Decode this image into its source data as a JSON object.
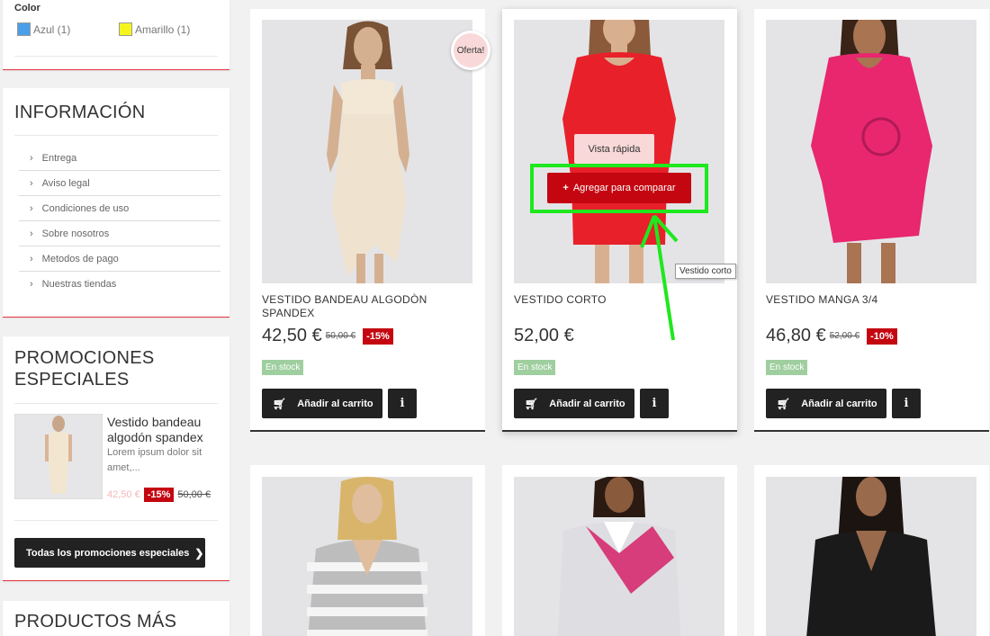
{
  "filter": {
    "color_label": "Color",
    "options": [
      {
        "label": "Azul (1)",
        "color": "#4a9fe8"
      },
      {
        "label": "Amarillo (1)",
        "color": "#f5f51e"
      }
    ]
  },
  "info_block": {
    "title": "INFORMACIÓN",
    "links": [
      "Entrega",
      "Aviso legal",
      "Condiciones de uso",
      "Sobre nosotros",
      "Metodos de pago",
      "Nuestras tiendas"
    ]
  },
  "promo_block": {
    "title": "PROMOCIONES ESPECIALES",
    "product_name": "Vestido bandeau algodón spandex",
    "description": "Lorem ipsum dolor sit amet,...",
    "price": "42,50 €",
    "discount": "-15%",
    "old_price": "50,00 €",
    "all_button": "Todas los promociones especiales"
  },
  "more_block": {
    "title": "PRODUCTOS MÁS"
  },
  "products": [
    {
      "name": "VESTIDO BANDEAU ALGODÒN SPANDEX",
      "price": "42,50 €",
      "old_price": "50,00 €",
      "discount": "-15%",
      "stock": "En stock",
      "cart": "Añadir al carrito",
      "info": "i",
      "badge": "Oferta!"
    },
    {
      "name": "VESTIDO CORTO",
      "price": "52,00 €",
      "old_price": "",
      "discount": "",
      "stock": "En stock",
      "cart": "Añadir al carrito",
      "info": "i",
      "quick_view": "Vista rápida",
      "compare": "Agregar para comparar",
      "tooltip": "Vestido corto"
    },
    {
      "name": "VESTIDO MANGA 3/4",
      "price": "46,80 €",
      "old_price": "52,00 €",
      "discount": "-10%",
      "stock": "En stock",
      "cart": "Añadir al carrito",
      "info": "i"
    }
  ],
  "colors": {
    "accent_red": "#c40611",
    "highlight_green": "#1ee81e",
    "stock_green": "#9fce9f"
  }
}
